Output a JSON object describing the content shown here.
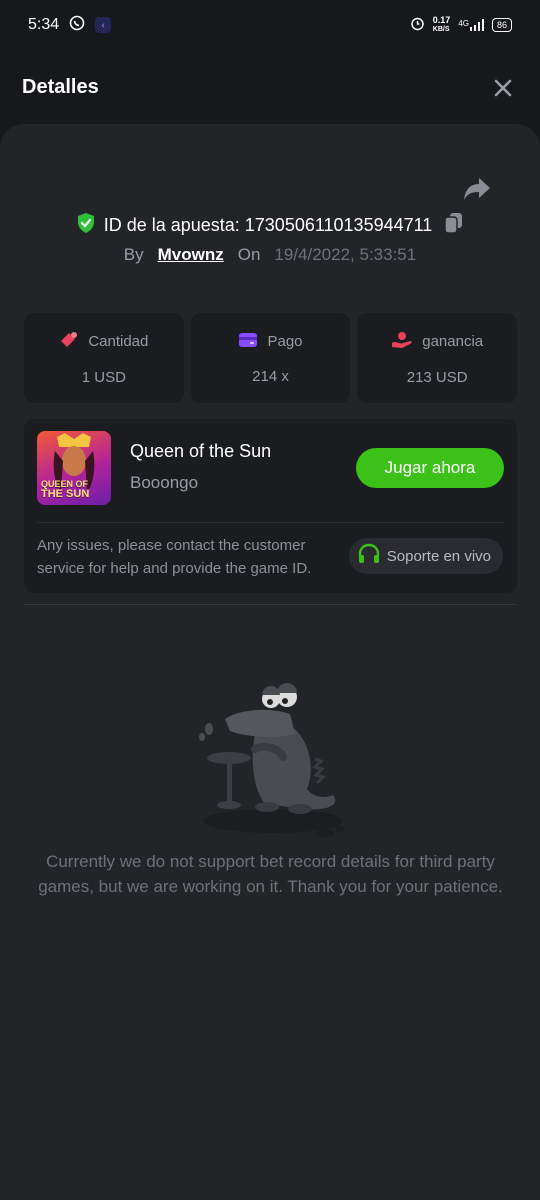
{
  "status_bar": {
    "time": "5:34",
    "network_speed": "0.17",
    "network_unit": "KB/S",
    "network_type": "4G",
    "battery": "86"
  },
  "header": {
    "title": "Detalles",
    "close_icon": "close-icon"
  },
  "bet": {
    "id_label": "ID de la apuesta: 1730506110135944711",
    "by_label": "By",
    "user": "Mvownz",
    "on_label": "On",
    "date": "19/4/2022, 5:33:51"
  },
  "stats": [
    {
      "label": "Cantidad",
      "value": "1 USD",
      "icon": "coins-icon",
      "color": "#e8425f"
    },
    {
      "label": "Pago",
      "value": "214 x",
      "icon": "wallet-icon",
      "color": "#8a4bff"
    },
    {
      "label": "ganancia",
      "value": "213 USD",
      "icon": "profit-icon",
      "color": "#e8425f"
    }
  ],
  "game": {
    "name": "Queen of the Sun",
    "provider": "Booongo",
    "play_label": "Jugar ahora",
    "thumb_line1": "QUEEN OF",
    "thumb_line2": "THE SUN"
  },
  "support": {
    "text": "Any issues, please contact the customer service for help and provide the game ID.",
    "button_label": "Soporte en vivo"
  },
  "empty_state": {
    "message": "Currently we do not support bet record details for third party games, but we are working on it. Thank you for your patience."
  },
  "colors": {
    "accent_green": "#3bc117",
    "shield_green": "#2fbf3a",
    "background": "#17181b",
    "sheet": "#232428",
    "card": "#1b1c1f"
  }
}
